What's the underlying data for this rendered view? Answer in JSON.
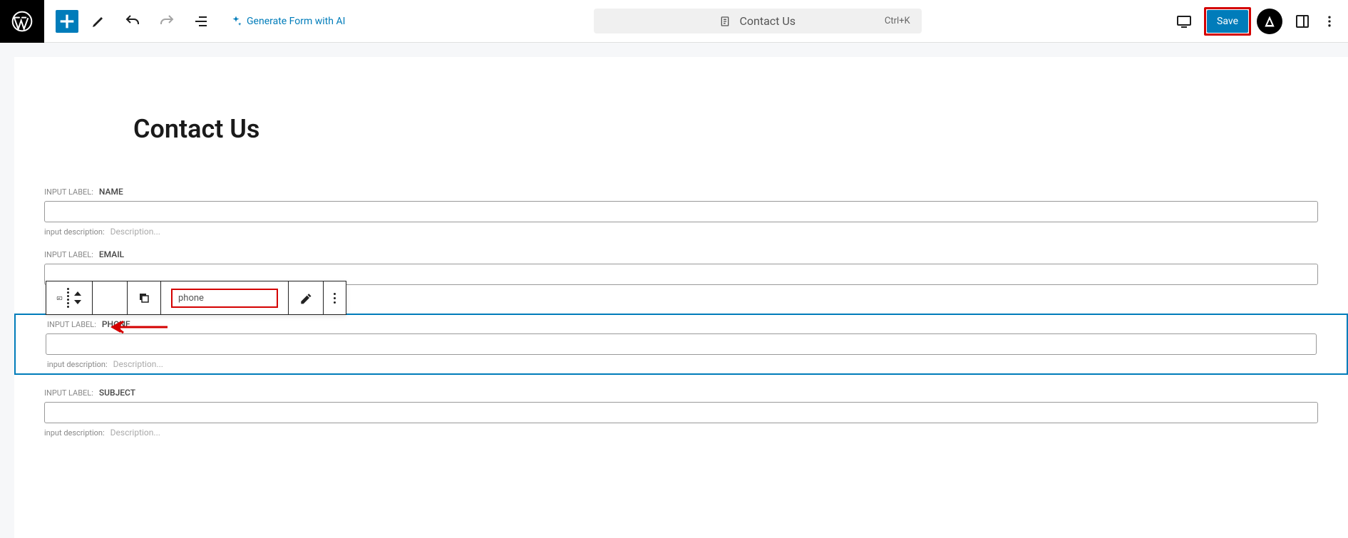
{
  "header": {
    "ai_label": "Generate Form with AI",
    "doc_title": "Contact Us",
    "shortcut": "Ctrl+K",
    "save_label": "Save"
  },
  "page": {
    "title": "Contact Us"
  },
  "fields": [
    {
      "label_prefix": "INPUT LABEL:",
      "label": "NAME",
      "desc_prefix": "input description:",
      "desc_placeholder": "Description..."
    },
    {
      "label_prefix": "INPUT LABEL:",
      "label": "EMAIL"
    },
    {
      "label_prefix": "INPUT LABEL:",
      "label": "PHONE",
      "desc_prefix": "input description:",
      "desc_placeholder": "Description..."
    },
    {
      "label_prefix": "INPUT LABEL:",
      "label": "SUBJECT",
      "desc_prefix": "input description:",
      "desc_placeholder": "Description..."
    }
  ],
  "block_toolbar": {
    "block_name_value": "phone"
  }
}
